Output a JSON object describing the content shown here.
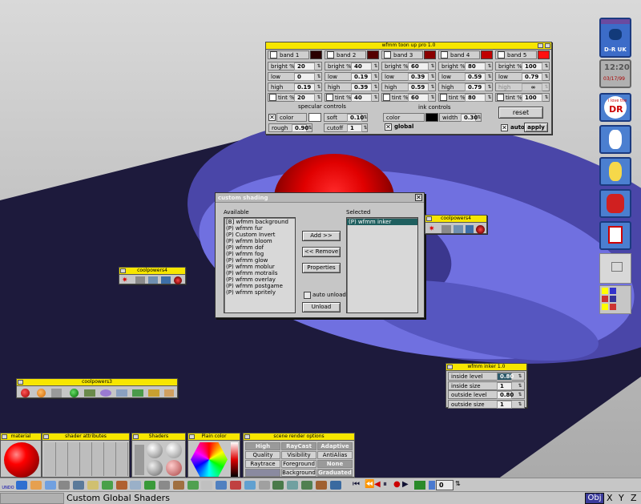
{
  "toonup": {
    "title": "wfmm toon up pro 1.0",
    "bands": [
      {
        "label": "band 1",
        "color": "#2a0000",
        "bright": "20",
        "low": "0",
        "high": "0.19",
        "tint": "20"
      },
      {
        "label": "band 2",
        "color": "#550000",
        "bright": "40",
        "low": "0.19",
        "high": "0.39",
        "tint": "40"
      },
      {
        "label": "band 3",
        "color": "#8a0000",
        "bright": "60",
        "low": "0.39",
        "high": "0.59",
        "tint": "60"
      },
      {
        "label": "band 4",
        "color": "#c00000",
        "bright": "80",
        "low": "0.59",
        "high": "0.79",
        "tint": "80"
      },
      {
        "label": "band 5",
        "color": "#ff1010",
        "bright": "100",
        "low": "0.79",
        "high": "",
        "tint": "100"
      }
    ],
    "row_labels": {
      "bright": "bright %",
      "low": "low",
      "high": "high",
      "tint": "tint %"
    },
    "specular": {
      "title": "specular controls",
      "color_label": "color",
      "soft_label": "soft",
      "soft": "0.10",
      "rough_label": "rough",
      "rough": "0.90",
      "cutoff_label": "cutoff",
      "cutoff": "1"
    },
    "ink": {
      "title": "ink controls",
      "color_label": "color",
      "width_label": "width",
      "width": "0.30",
      "global_label": "global"
    },
    "reset_label": "reset",
    "auto_label": "auto",
    "apply_label": "apply",
    "infinity": "∞"
  },
  "dialog": {
    "title": "custom shading",
    "available_label": "Available",
    "selected_label": "Selected",
    "available": [
      "[B] wfmm background",
      "(P) wfmm fur",
      "(P) Custom Invert",
      "(P) wfmm bloom",
      "(P) wfmm dof",
      "(P) wfmm fog",
      "(P) wfmm glow",
      "(P) wfmm moblur",
      "(P) wfmm motrails",
      "(P) wfmm overlay",
      "(P) wfmm postgame",
      "(P) wfmm spritely"
    ],
    "selected": [
      "(P) wfmm inker"
    ],
    "add_label": "Add >>",
    "remove_label": "<< Remove",
    "properties_label": "Properties",
    "auto_unload_label": "auto unload",
    "unload_label": "Unload"
  },
  "coolpowers4_a": {
    "title": "coolpowers4"
  },
  "coolpowers4_b": {
    "title": "coolpowers4"
  },
  "coolpowers3": {
    "title": "coolpowers3"
  },
  "inker": {
    "title": "wfmm inker 1.0",
    "rows": [
      {
        "label": "inside level",
        "value": "0.80"
      },
      {
        "label": "inside size",
        "value": "1"
      },
      {
        "label": "outside level",
        "value": "0.80"
      },
      {
        "label": "outside size",
        "value": "1"
      }
    ]
  },
  "dock": {
    "material_title": "material",
    "shader_attr_title": "shader attributes",
    "shaders_title": "Shaders",
    "plain_color_title": "Plain color",
    "scene_title": "scene render options",
    "scene_buttons": [
      [
        "High",
        "RayCast",
        "Adaptive"
      ],
      [
        "Quality",
        "Visibility",
        "AntiAlias"
      ],
      [
        "Raytrace",
        "Foreground",
        "None"
      ],
      [
        "",
        "Background",
        "Graduated"
      ]
    ]
  },
  "sidebar": {
    "logo_text": "D-R UK",
    "clock_time": "12:20",
    "clock_date": "03/17/99",
    "love_text": "i love the",
    "love_brand": "DR"
  },
  "toolbar": {
    "frame_value": "0",
    "undo_label": "UNDO"
  },
  "status": {
    "text": "Custom Global Shaders",
    "axes": [
      "Obj",
      "X",
      "Y",
      "Z"
    ]
  },
  "colors": {
    "yellow_bar": "#f7e600",
    "purple_bar": "#6a4aa0",
    "floor": "#1d1a3c",
    "disc": "#6a6ad8"
  }
}
